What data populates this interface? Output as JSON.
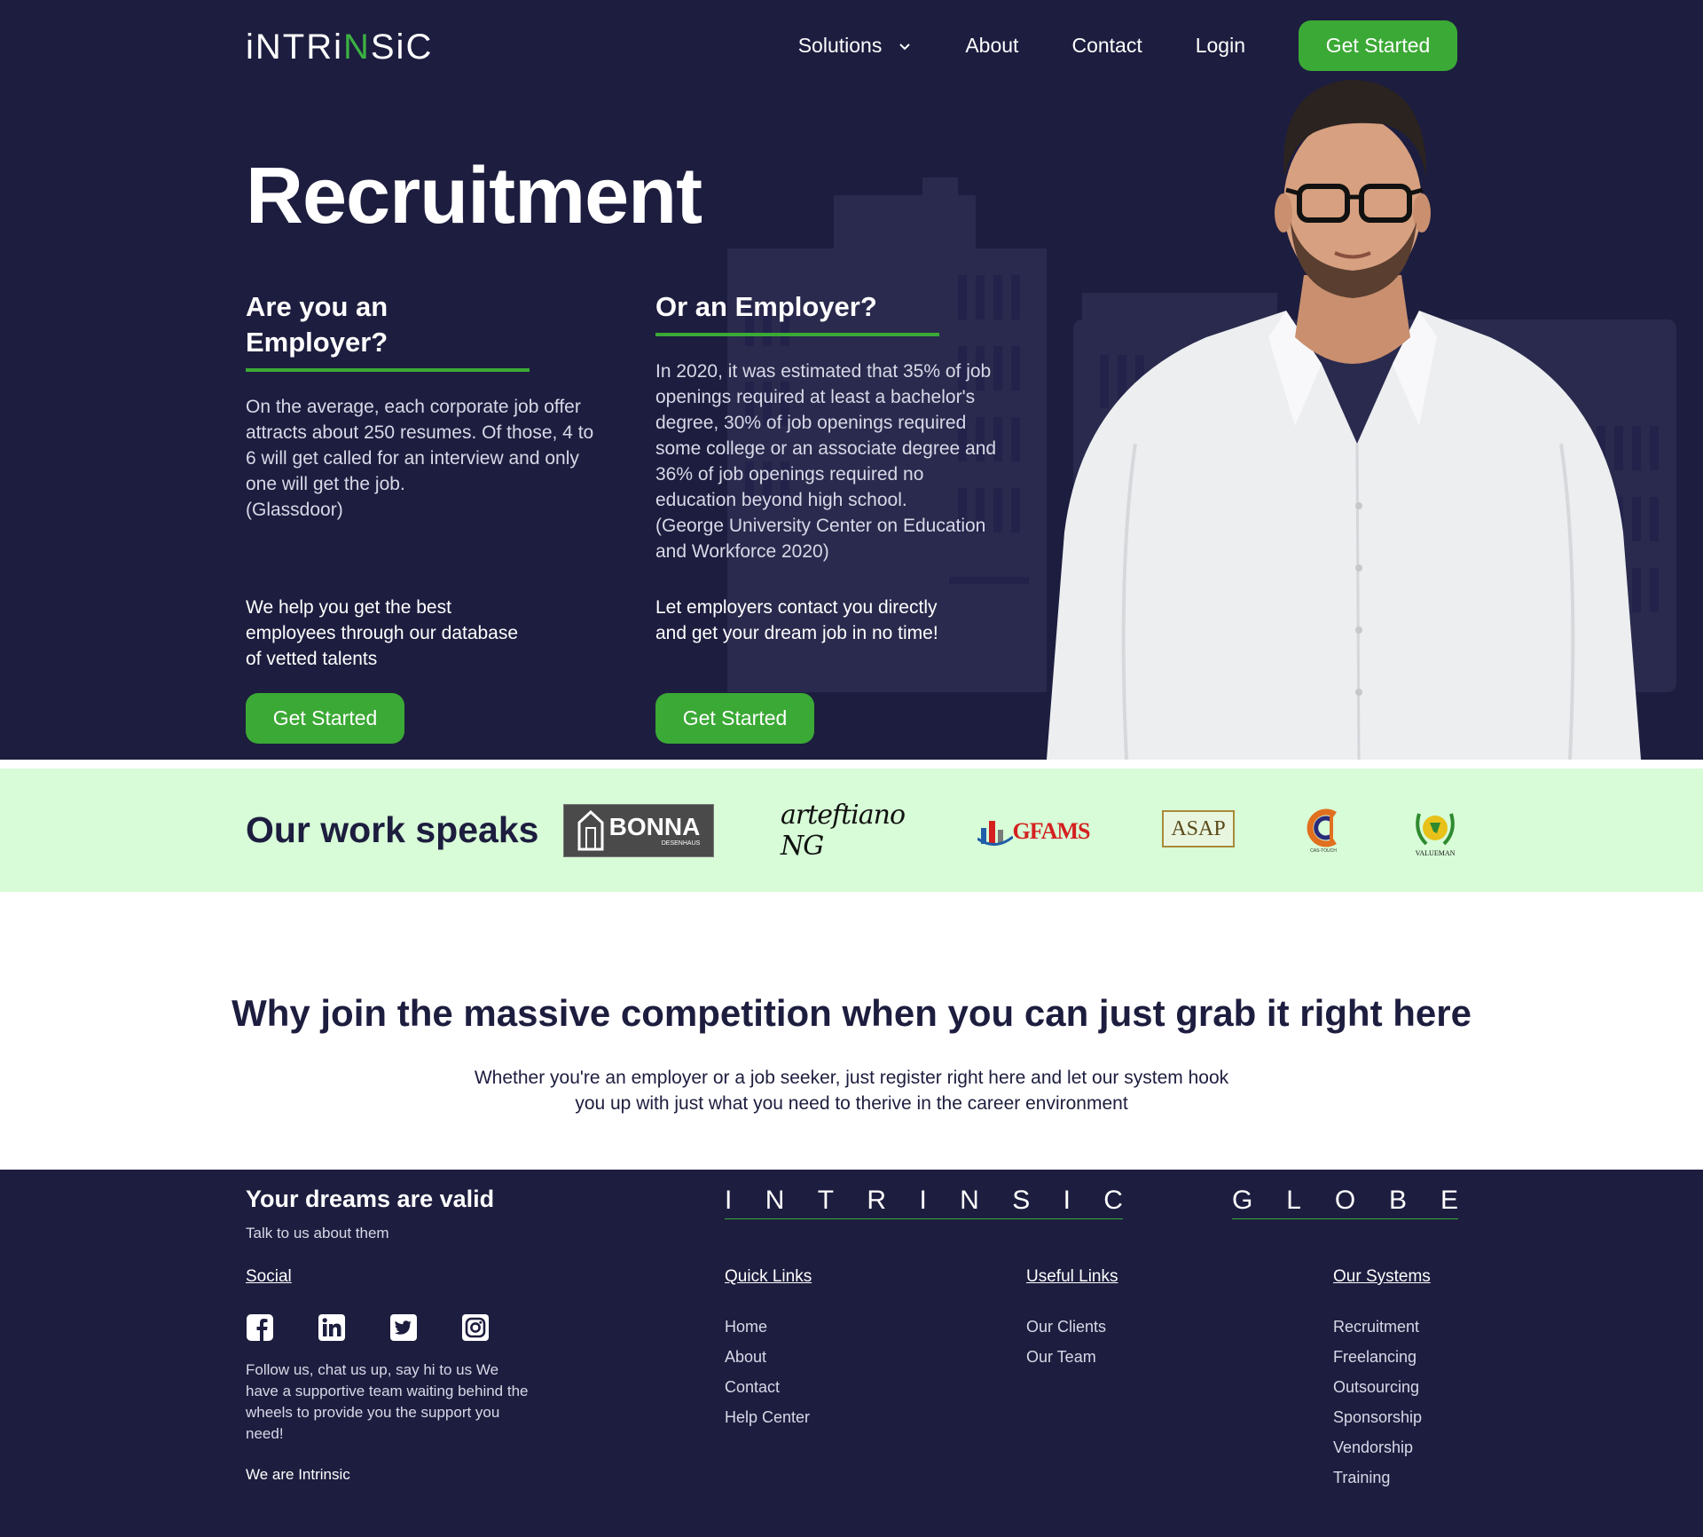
{
  "brand": {
    "logo_text_pre": "iNTRi",
    "logo_text_green": "N",
    "logo_text_post": "SiC"
  },
  "nav": {
    "items": [
      {
        "label": "Solutions"
      },
      {
        "label": "About"
      },
      {
        "label": "Contact"
      },
      {
        "label": "Login"
      }
    ],
    "cta": "Get Started"
  },
  "hero": {
    "title": "Recruitment",
    "employer": {
      "heading": "Are you an Employer?",
      "stat": "On the average, each corporate job offer attracts about 250 resumes. Of those, 4 to 6 will get called for an interview and only one will get the job.\n(Glassdoor)",
      "pitch": "We help you get the best employees through our database of vetted talents",
      "cta": "Get Started"
    },
    "seeker": {
      "heading": "Or an Employer?",
      "stat": "In 2020, it was estimated that 35% of job openings required at least a bachelor's degree, 30% of job openings required some college or an associate degree and 36% of job openings required no education beyond high school.\n(George University Center on Education and Workforce 2020)",
      "pitch": "Let employers contact you directly and get your dream job in no time!",
      "cta": "Get Started"
    }
  },
  "partners": {
    "title": "Our work speaks",
    "logos": [
      {
        "name": "BONNA",
        "sub": "DESENHAUS"
      },
      {
        "name": "arteftiano NG"
      },
      {
        "name": "GFAMS"
      },
      {
        "name": "ASAP"
      },
      {
        "name": "CAS-TOUCH"
      },
      {
        "name": "VALUEMAN"
      }
    ]
  },
  "why": {
    "title": "Why join the massive competition when you can just grab it right here",
    "text": "Whether you're an employer or a job seeker, just register right here and let our system hook you up with just what you need to therive in the career environment"
  },
  "footer": {
    "dreams": "Your dreams are valid",
    "talk": "Talk to us about them",
    "social_heading": "Social",
    "icons": [
      "facebook-icon",
      "linkedin-icon",
      "twitter-icon",
      "instagram-icon"
    ],
    "follow": "Follow us, chat us up, say hi to us We have a supportive team waiting behind the wheels to provide you the support you need!",
    "we_are": "We are Intrinsic",
    "brand_word1": [
      "I",
      "N",
      "T",
      "R",
      "I",
      "N",
      "S",
      "I",
      "C"
    ],
    "brand_word2": [
      "G",
      "L",
      "O",
      "B",
      "E"
    ],
    "quick_links": {
      "heading": "Quick Links",
      "items": [
        "Home",
        "About",
        "Contact",
        "Help Center"
      ]
    },
    "useful_links": {
      "heading": "Useful Links",
      "items": [
        "Our Clients",
        "Our Team"
      ]
    },
    "our_systems": {
      "heading": "Our Systems",
      "items": [
        "Recruitment",
        "Freelancing",
        "Outsourcing",
        "Sponsorship",
        "Vendorship",
        "Training"
      ]
    }
  },
  "colors": {
    "navy": "#1d1d3f",
    "green": "#3ba935",
    "mint": "#d7fcd7"
  }
}
